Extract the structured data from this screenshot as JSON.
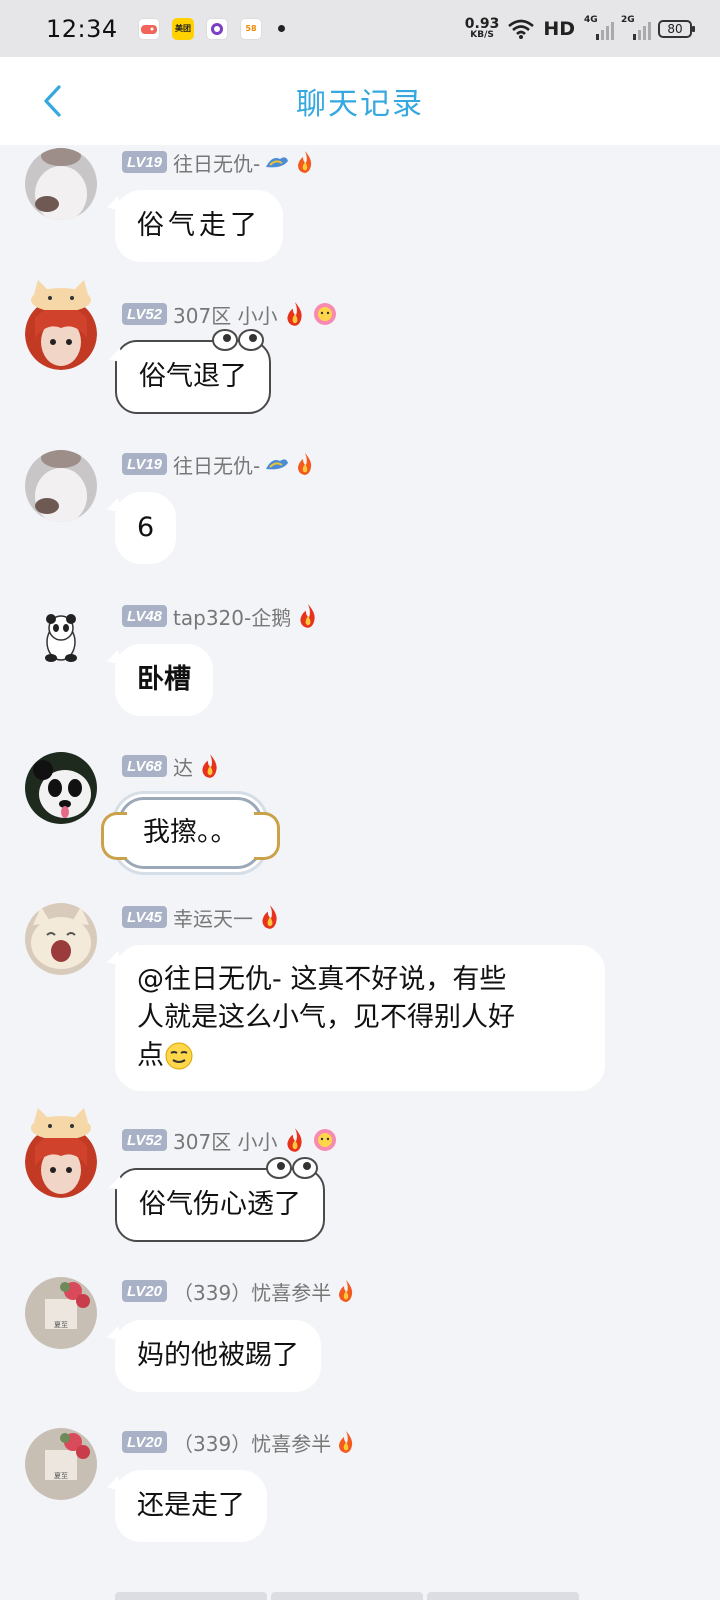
{
  "status_bar": {
    "time": "12:34",
    "speed_value": "0.93",
    "speed_unit": "KB/S",
    "hd_label": "HD",
    "net1": "4G",
    "net2": "2G",
    "battery": "80",
    "app1": "",
    "app2": "美团",
    "app3": "",
    "app4": "58"
  },
  "header": {
    "title": "聊天记录"
  },
  "messages": [
    {
      "level": "LV19",
      "name": "往日无仇-",
      "text": "俗气走了"
    },
    {
      "level": "LV52",
      "name": "307区 小小",
      "text": "俗气退了"
    },
    {
      "level": "LV19",
      "name": "往日无仇-",
      "text": "6"
    },
    {
      "level": "LV48",
      "name": "tap320-企鹅",
      "text": "卧槽"
    },
    {
      "level": "LV68",
      "name": "达",
      "text": "我擦。。"
    },
    {
      "level": "LV45",
      "name": "幸运天一",
      "text_line1": "@往日无仇- 这真不好说，有些",
      "text_line2": "人就是这么小气，见不得别人好",
      "text_line3": "点"
    },
    {
      "level": "LV52",
      "name": "307区 小小",
      "text": "俗气伤心透了"
    },
    {
      "level": "LV20",
      "name": "（339）忧喜参半",
      "text": "妈的他被踢了"
    },
    {
      "level": "LV20",
      "name": "（339）忧喜参半",
      "text": "还是走了"
    }
  ],
  "avatar_card_label": "夏至",
  "colors": {
    "accent": "#35a8e0",
    "level_badge": "#a9b1c6",
    "background": "#f3f4f8"
  }
}
